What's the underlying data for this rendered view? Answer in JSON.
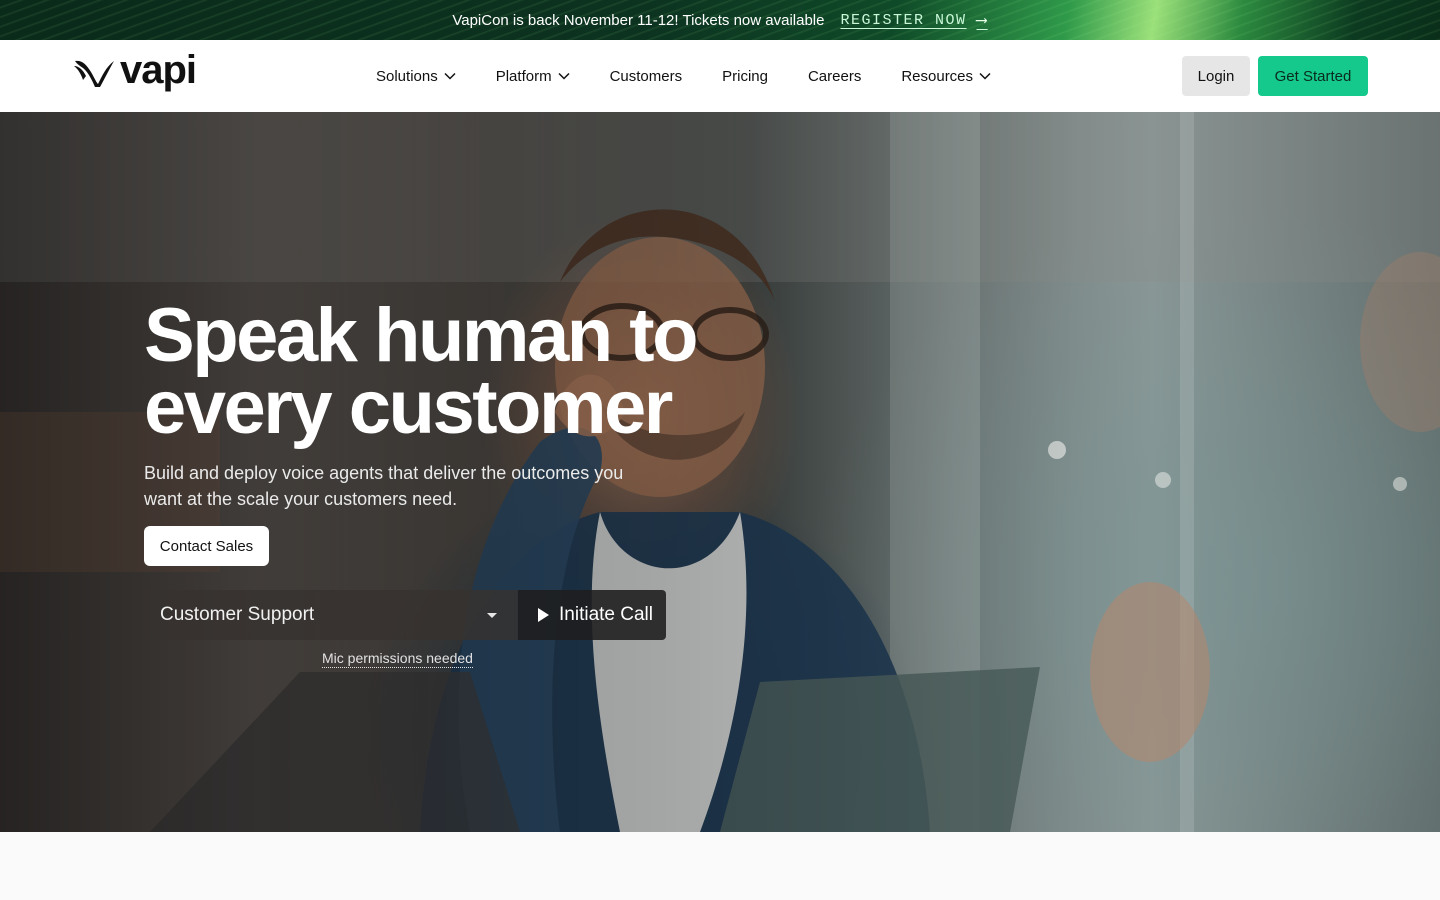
{
  "banner": {
    "text": "VapiCon is back November 11-12! Tickets now available",
    "link_label": "REGISTER NOW",
    "arrow": "⟶"
  },
  "header": {
    "logo_text": "vapi",
    "nav": [
      {
        "label": "Solutions",
        "has_dropdown": true
      },
      {
        "label": "Platform",
        "has_dropdown": true
      },
      {
        "label": "Customers",
        "has_dropdown": false
      },
      {
        "label": "Pricing",
        "has_dropdown": false
      },
      {
        "label": "Careers",
        "has_dropdown": false
      },
      {
        "label": "Resources",
        "has_dropdown": true
      }
    ],
    "login_label": "Login",
    "get_started_label": "Get Started",
    "accent_color": "#14c98b"
  },
  "hero": {
    "title_line1": "Speak human to",
    "title_line2": "every customer",
    "subtitle": "Build and deploy voice agents that deliver the outcomes you want at the scale your customers need.",
    "contact_label": "Contact Sales",
    "select_value": "Customer Support",
    "call_label": "Initiate Call",
    "mic_note": "Mic permissions needed"
  }
}
